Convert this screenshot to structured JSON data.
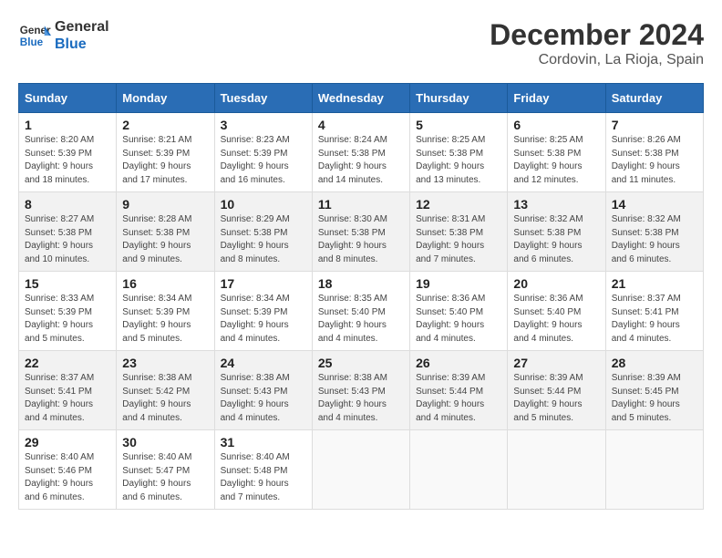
{
  "header": {
    "logo_line1": "General",
    "logo_line2": "Blue",
    "month_year": "December 2024",
    "location": "Cordovin, La Rioja, Spain"
  },
  "weekdays": [
    "Sunday",
    "Monday",
    "Tuesday",
    "Wednesday",
    "Thursday",
    "Friday",
    "Saturday"
  ],
  "weeks": [
    [
      {
        "day": "1",
        "sunrise": "8:20 AM",
        "sunset": "5:39 PM",
        "daylight": "9 hours and 18 minutes."
      },
      {
        "day": "2",
        "sunrise": "8:21 AM",
        "sunset": "5:39 PM",
        "daylight": "9 hours and 17 minutes."
      },
      {
        "day": "3",
        "sunrise": "8:23 AM",
        "sunset": "5:39 PM",
        "daylight": "9 hours and 16 minutes."
      },
      {
        "day": "4",
        "sunrise": "8:24 AM",
        "sunset": "5:38 PM",
        "daylight": "9 hours and 14 minutes."
      },
      {
        "day": "5",
        "sunrise": "8:25 AM",
        "sunset": "5:38 PM",
        "daylight": "9 hours and 13 minutes."
      },
      {
        "day": "6",
        "sunrise": "8:25 AM",
        "sunset": "5:38 PM",
        "daylight": "9 hours and 12 minutes."
      },
      {
        "day": "7",
        "sunrise": "8:26 AM",
        "sunset": "5:38 PM",
        "daylight": "9 hours and 11 minutes."
      }
    ],
    [
      {
        "day": "8",
        "sunrise": "8:27 AM",
        "sunset": "5:38 PM",
        "daylight": "9 hours and 10 minutes."
      },
      {
        "day": "9",
        "sunrise": "8:28 AM",
        "sunset": "5:38 PM",
        "daylight": "9 hours and 9 minutes."
      },
      {
        "day": "10",
        "sunrise": "8:29 AM",
        "sunset": "5:38 PM",
        "daylight": "9 hours and 8 minutes."
      },
      {
        "day": "11",
        "sunrise": "8:30 AM",
        "sunset": "5:38 PM",
        "daylight": "9 hours and 8 minutes."
      },
      {
        "day": "12",
        "sunrise": "8:31 AM",
        "sunset": "5:38 PM",
        "daylight": "9 hours and 7 minutes."
      },
      {
        "day": "13",
        "sunrise": "8:32 AM",
        "sunset": "5:38 PM",
        "daylight": "9 hours and 6 minutes."
      },
      {
        "day": "14",
        "sunrise": "8:32 AM",
        "sunset": "5:38 PM",
        "daylight": "9 hours and 6 minutes."
      }
    ],
    [
      {
        "day": "15",
        "sunrise": "8:33 AM",
        "sunset": "5:39 PM",
        "daylight": "9 hours and 5 minutes."
      },
      {
        "day": "16",
        "sunrise": "8:34 AM",
        "sunset": "5:39 PM",
        "daylight": "9 hours and 5 minutes."
      },
      {
        "day": "17",
        "sunrise": "8:34 AM",
        "sunset": "5:39 PM",
        "daylight": "9 hours and 4 minutes."
      },
      {
        "day": "18",
        "sunrise": "8:35 AM",
        "sunset": "5:40 PM",
        "daylight": "9 hours and 4 minutes."
      },
      {
        "day": "19",
        "sunrise": "8:36 AM",
        "sunset": "5:40 PM",
        "daylight": "9 hours and 4 minutes."
      },
      {
        "day": "20",
        "sunrise": "8:36 AM",
        "sunset": "5:40 PM",
        "daylight": "9 hours and 4 minutes."
      },
      {
        "day": "21",
        "sunrise": "8:37 AM",
        "sunset": "5:41 PM",
        "daylight": "9 hours and 4 minutes."
      }
    ],
    [
      {
        "day": "22",
        "sunrise": "8:37 AM",
        "sunset": "5:41 PM",
        "daylight": "9 hours and 4 minutes."
      },
      {
        "day": "23",
        "sunrise": "8:38 AM",
        "sunset": "5:42 PM",
        "daylight": "9 hours and 4 minutes."
      },
      {
        "day": "24",
        "sunrise": "8:38 AM",
        "sunset": "5:43 PM",
        "daylight": "9 hours and 4 minutes."
      },
      {
        "day": "25",
        "sunrise": "8:38 AM",
        "sunset": "5:43 PM",
        "daylight": "9 hours and 4 minutes."
      },
      {
        "day": "26",
        "sunrise": "8:39 AM",
        "sunset": "5:44 PM",
        "daylight": "9 hours and 4 minutes."
      },
      {
        "day": "27",
        "sunrise": "8:39 AM",
        "sunset": "5:44 PM",
        "daylight": "9 hours and 5 minutes."
      },
      {
        "day": "28",
        "sunrise": "8:39 AM",
        "sunset": "5:45 PM",
        "daylight": "9 hours and 5 minutes."
      }
    ],
    [
      {
        "day": "29",
        "sunrise": "8:40 AM",
        "sunset": "5:46 PM",
        "daylight": "9 hours and 6 minutes."
      },
      {
        "day": "30",
        "sunrise": "8:40 AM",
        "sunset": "5:47 PM",
        "daylight": "9 hours and 6 minutes."
      },
      {
        "day": "31",
        "sunrise": "8:40 AM",
        "sunset": "5:48 PM",
        "daylight": "9 hours and 7 minutes."
      },
      null,
      null,
      null,
      null
    ]
  ]
}
